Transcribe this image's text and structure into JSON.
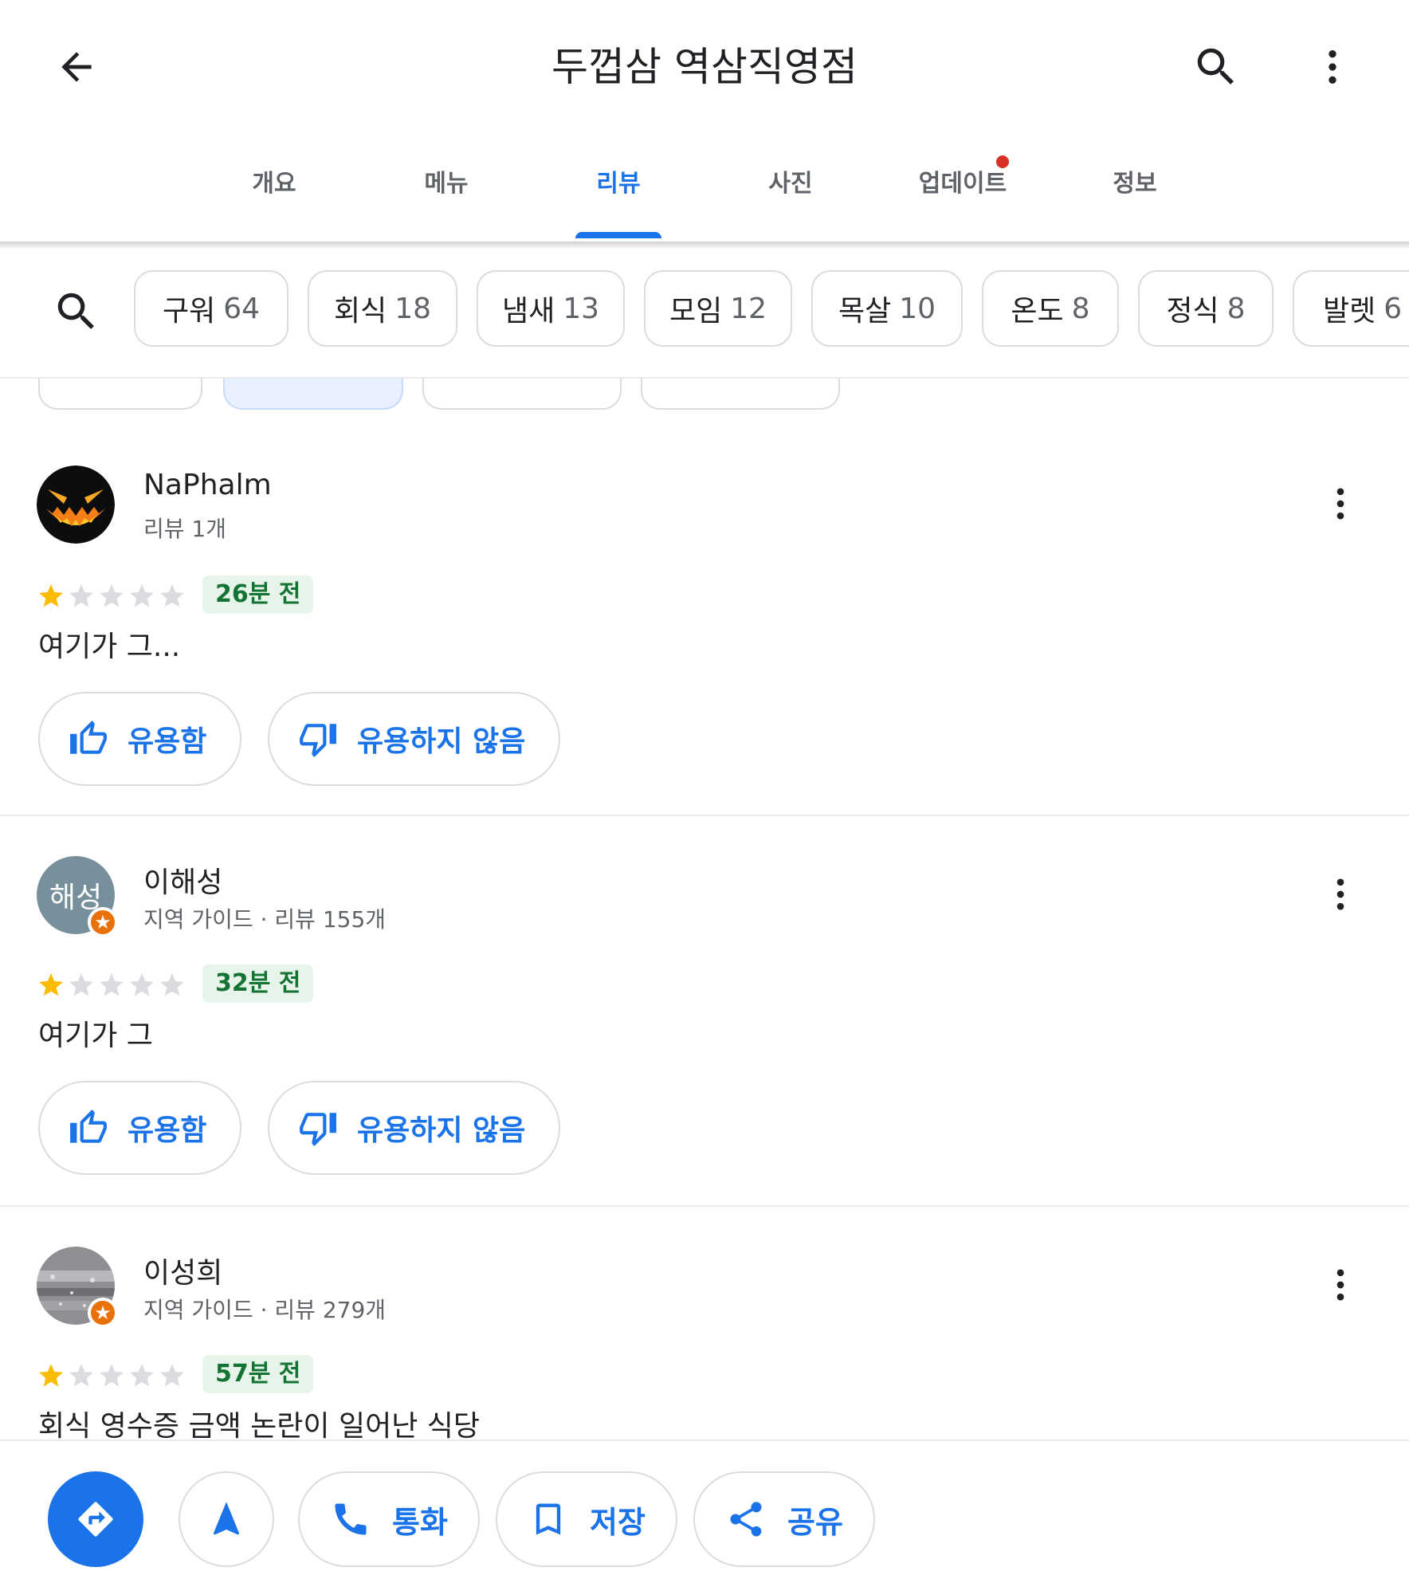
{
  "header": {
    "title": "두껍삼 역삼직영점",
    "back_icon": "arrow-back-icon",
    "search_icon": "search-icon",
    "more_icon": "more-vert-icon"
  },
  "tabs": [
    {
      "label": "개요",
      "active": false
    },
    {
      "label": "메뉴",
      "active": false
    },
    {
      "label": "리뷰",
      "active": true
    },
    {
      "label": "사진",
      "active": false
    },
    {
      "label": "업데이트",
      "active": false,
      "has_dot": true
    },
    {
      "label": "정보",
      "active": false
    }
  ],
  "topic_chips": [
    {
      "label": "구워",
      "count": "64"
    },
    {
      "label": "회식",
      "count": "18"
    },
    {
      "label": "냄새",
      "count": "13"
    },
    {
      "label": "모임",
      "count": "12"
    },
    {
      "label": "목살",
      "count": "10"
    },
    {
      "label": "온도",
      "count": "8"
    },
    {
      "label": "정식",
      "count": "8"
    },
    {
      "label": "발렛",
      "count": "6"
    }
  ],
  "reviews": [
    {
      "name": "NaPhalm",
      "sub": "리뷰 1개",
      "rating": 1,
      "time": "26분 전",
      "text": "여기가 그...",
      "helpful_label": "유용함",
      "not_helpful_label": "유용하지 않음"
    },
    {
      "name": "이해성",
      "sub": "지역 가이드 · 리뷰 155개",
      "avatar_text": "해성",
      "rating": 1,
      "time": "32분 전",
      "text": "여기가 그",
      "helpful_label": "유용함",
      "not_helpful_label": "유용하지 않음"
    },
    {
      "name": "이성희",
      "sub": "지역 가이드 · 리뷰 279개",
      "rating": 1,
      "time": "57분 전",
      "text": "회식 영수증 금액 논란이 일어난 식당"
    }
  ],
  "bottom_bar": {
    "call_label": "통화",
    "save_label": "저장",
    "share_label": "공유"
  },
  "colors": {
    "accent": "#1a73e8",
    "time_badge_bg": "#e6f4ea",
    "time_badge_text": "#137333",
    "star": "#fbbc04",
    "local_guide_badge": "#e8710a"
  }
}
